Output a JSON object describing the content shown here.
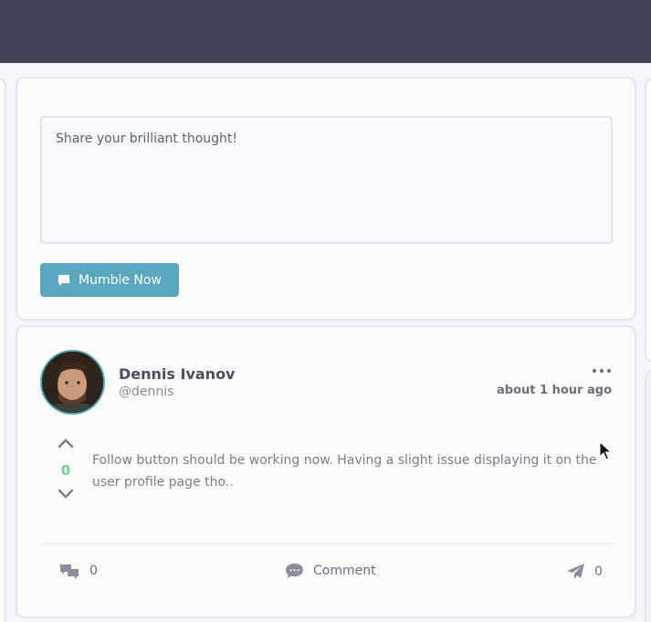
{
  "compose": {
    "placeholder": "Share your brilliant thought!",
    "submit_label": "Mumble Now",
    "submit_icon": "speech-bubble-icon"
  },
  "post": {
    "author_name": "Dennis Ivanov",
    "author_handle": "@dennis",
    "time": "about 1 hour ago",
    "vote_count": "0",
    "text": "Follow button should be working now. Having a slight issue displaying it on the user profile page tho..",
    "footer": {
      "comments_count": "0",
      "comment_label": "Comment",
      "shares_count": "0"
    }
  },
  "colors": {
    "topbar": "#3f4259",
    "accent": "#5aa6bd",
    "vote": "#6fcf97"
  }
}
